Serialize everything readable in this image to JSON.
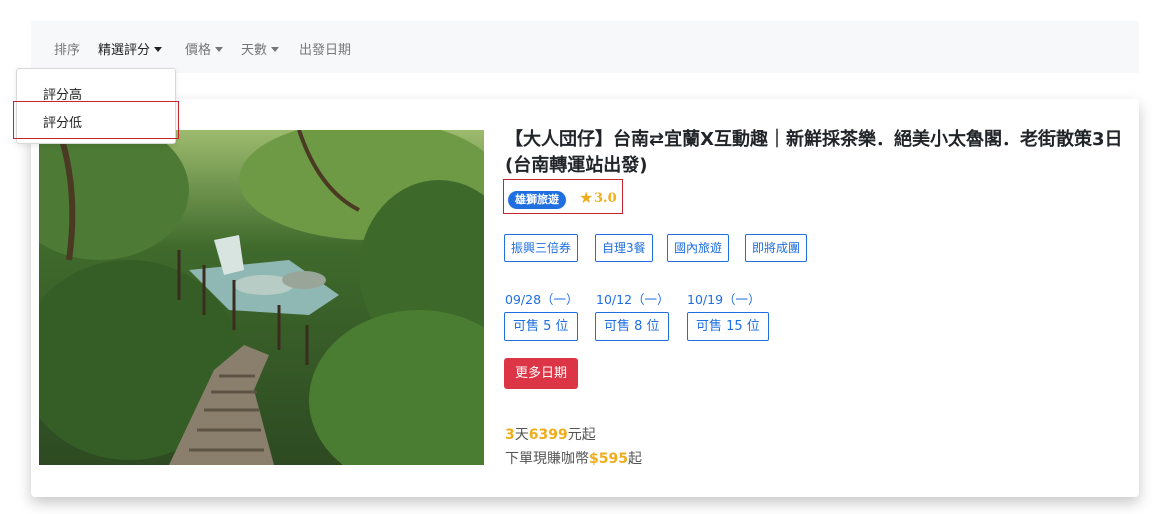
{
  "sortbar": {
    "sort_label": "排序",
    "featured_rating": "精選評分",
    "price": "價格",
    "days": "天數",
    "departure_date": "出發日期"
  },
  "dropdown": {
    "items": [
      "評分高",
      "評分低"
    ]
  },
  "tour": {
    "title": "【大人団仔】台南⇄宜蘭X互動趣｜新鮮採茶樂．絕美小太魯閣．老街散策3日(台南轉運站出發)",
    "agency": "雄獅旅遊",
    "rating": "3.0",
    "tags": [
      "振興三倍券",
      "自理3餐",
      "國內旅遊",
      "即將成團"
    ],
    "departures": [
      {
        "date": "09/28（一）",
        "seats": "可售 5 位"
      },
      {
        "date": "10/12（一）",
        "seats": "可售 8 位"
      },
      {
        "date": "10/19（一）",
        "seats": "可售 15 位"
      }
    ],
    "more_dates": "更多日期",
    "price": {
      "days": "3",
      "days_unit": "天",
      "amount": "6399",
      "suffix": "元起"
    },
    "bonus": {
      "prefix": "下單現賺咖幣",
      "amount": "$595",
      "suffix": "起"
    }
  },
  "colors": {
    "accent": "#1f6fe0",
    "price_highlight": "#f0ad1b",
    "button_red": "#dc3545",
    "highlight_border": "#c8242f"
  },
  "icons": {
    "caret": "caret-down-icon",
    "star": "star-icon"
  }
}
